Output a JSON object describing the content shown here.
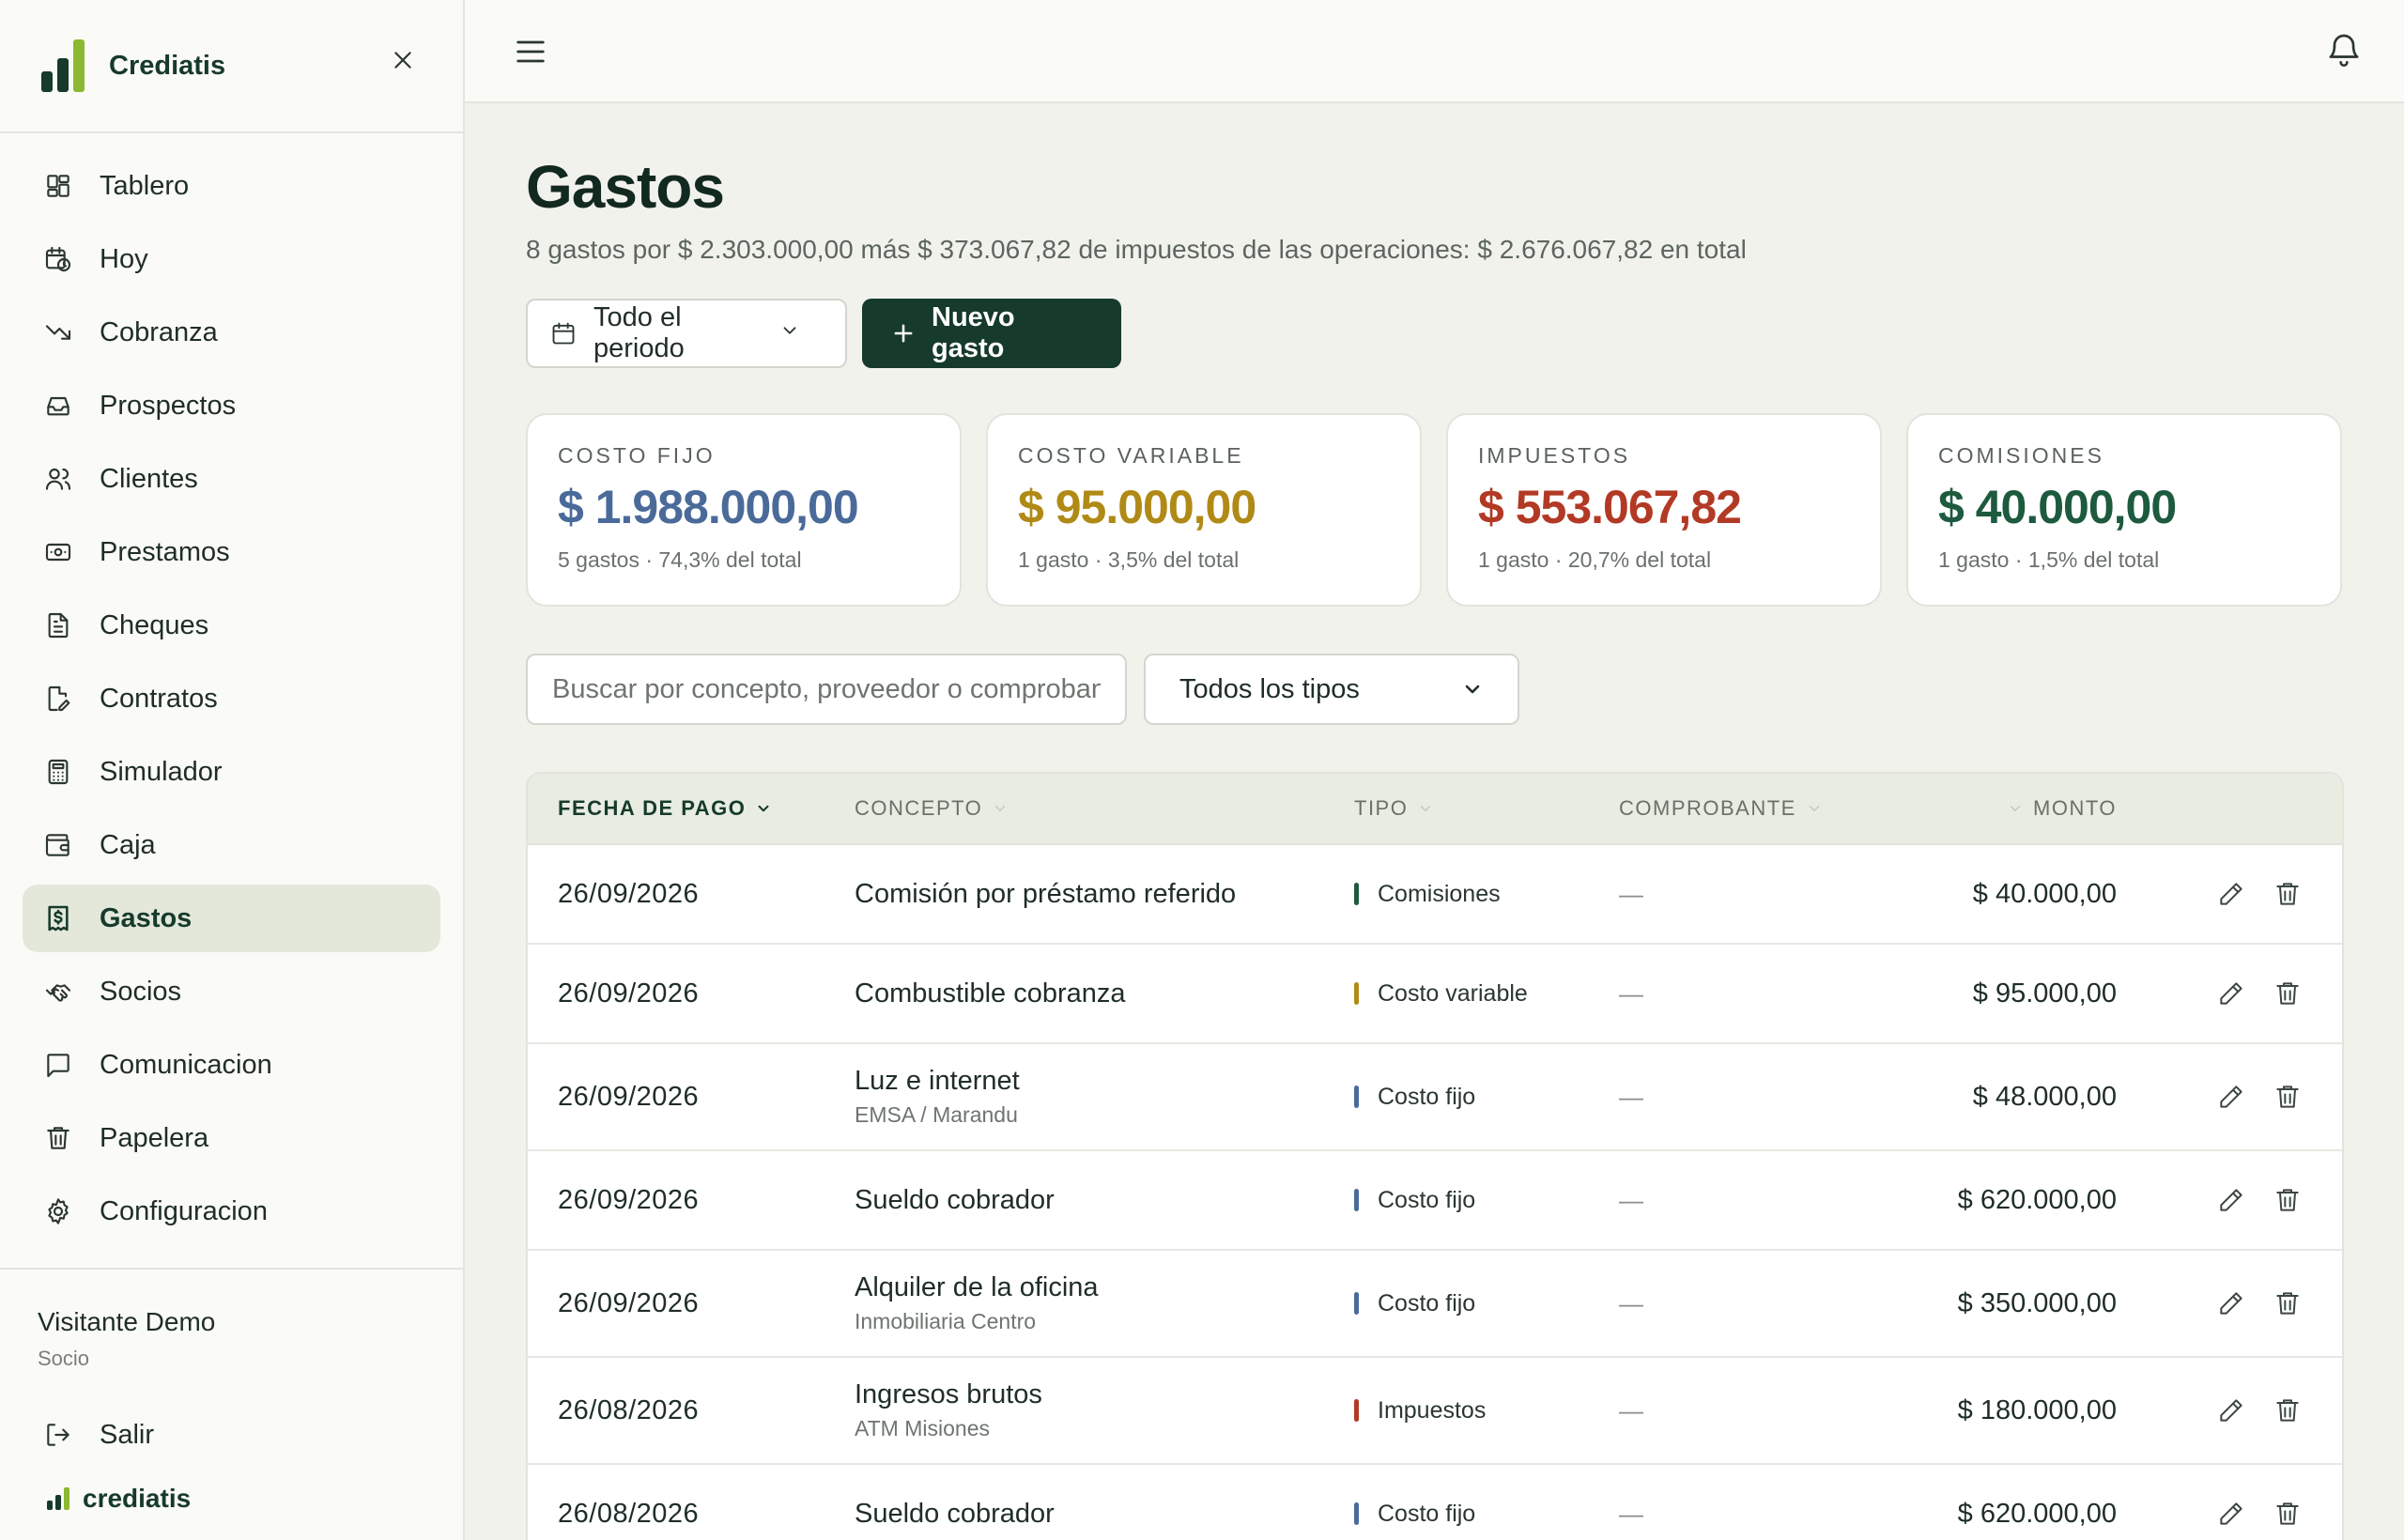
{
  "brand": {
    "name": "Crediatis",
    "footer_name": "crediatis"
  },
  "colors": {
    "primary": "#163a2b",
    "accent": "#8cb832",
    "costo_fijo": "#4a6a9a",
    "costo_variable": "#b08a16",
    "impuestos": "#b23a25",
    "comisiones": "#1d5a3e"
  },
  "sidebar": {
    "items": [
      {
        "label": "Tablero",
        "icon": "grid-icon"
      },
      {
        "label": "Hoy",
        "icon": "calendar-clock-icon"
      },
      {
        "label": "Cobranza",
        "icon": "trend-down-icon"
      },
      {
        "label": "Prospectos",
        "icon": "inbox-icon"
      },
      {
        "label": "Clientes",
        "icon": "users-icon"
      },
      {
        "label": "Prestamos",
        "icon": "banknote-icon"
      },
      {
        "label": "Cheques",
        "icon": "file-text-icon"
      },
      {
        "label": "Contratos",
        "icon": "file-edit-icon"
      },
      {
        "label": "Simulador",
        "icon": "calculator-icon"
      },
      {
        "label": "Caja",
        "icon": "wallet-icon"
      },
      {
        "label": "Gastos",
        "icon": "receipt-dollar-icon",
        "active": true
      },
      {
        "label": "Socios",
        "icon": "handshake-icon"
      },
      {
        "label": "Comunicacion",
        "icon": "message-square-icon"
      },
      {
        "label": "Papelera",
        "icon": "trash-icon"
      },
      {
        "label": "Configuracion",
        "icon": "gear-icon"
      }
    ],
    "user": {
      "name": "Visitante Demo",
      "role": "Socio"
    },
    "logout_label": "Salir"
  },
  "page": {
    "title": "Gastos",
    "subtitle": "8 gastos por $ 2.303.000,00 más $ 373.067,82 de impuestos de las operaciones: $ 2.676.067,82 en total",
    "period_label": "Todo el periodo",
    "new_label": "Nuevo gasto"
  },
  "cards": [
    {
      "label": "COSTO FIJO",
      "value": "$ 1.988.000,00",
      "meta": "5 gastos · 74,3% del total",
      "color": "#4a6a9a"
    },
    {
      "label": "COSTO VARIABLE",
      "value": "$ 95.000,00",
      "meta": "1 gasto · 3,5% del total",
      "color": "#b08a16"
    },
    {
      "label": "IMPUESTOS",
      "value": "$ 553.067,82",
      "meta": "1 gasto · 20,7% del total",
      "color": "#b23a25"
    },
    {
      "label": "COMISIONES",
      "value": "$ 40.000,00",
      "meta": "1 gasto · 1,5% del total",
      "color": "#1d5a3e"
    }
  ],
  "filters": {
    "search_placeholder": "Buscar por concepto, proveedor o comprobante",
    "type_selected": "Todos los tipos"
  },
  "table": {
    "headers": {
      "date": "FECHA DE PAGO",
      "concept": "CONCEPTO",
      "type": "TIPO",
      "voucher": "COMPROBANTE",
      "amount": "MONTO"
    },
    "rows": [
      {
        "date": "26/09/2026",
        "concept": "Comisión por préstamo referido",
        "provider": "",
        "type": "Comisiones",
        "type_color": "#1d5a3e",
        "voucher": "—",
        "amount": "$ 40.000,00"
      },
      {
        "date": "26/09/2026",
        "concept": "Combustible cobranza",
        "provider": "",
        "type": "Costo variable",
        "type_color": "#b08a16",
        "voucher": "—",
        "amount": "$ 95.000,00"
      },
      {
        "date": "26/09/2026",
        "concept": "Luz e internet",
        "provider": "EMSA / Marandu",
        "type": "Costo fijo",
        "type_color": "#4a6a9a",
        "voucher": "—",
        "amount": "$ 48.000,00"
      },
      {
        "date": "26/09/2026",
        "concept": "Sueldo cobrador",
        "provider": "",
        "type": "Costo fijo",
        "type_color": "#4a6a9a",
        "voucher": "—",
        "amount": "$ 620.000,00"
      },
      {
        "date": "26/09/2026",
        "concept": "Alquiler de la oficina",
        "provider": "Inmobiliaria Centro",
        "type": "Costo fijo",
        "type_color": "#4a6a9a",
        "voucher": "—",
        "amount": "$ 350.000,00"
      },
      {
        "date": "26/08/2026",
        "concept": "Ingresos brutos",
        "provider": "ATM Misiones",
        "type": "Impuestos",
        "type_color": "#b23a25",
        "voucher": "—",
        "amount": "$ 180.000,00"
      },
      {
        "date": "26/08/2026",
        "concept": "Sueldo cobrador",
        "provider": "",
        "type": "Costo fijo",
        "type_color": "#4a6a9a",
        "voucher": "—",
        "amount": "$ 620.000,00"
      }
    ]
  }
}
